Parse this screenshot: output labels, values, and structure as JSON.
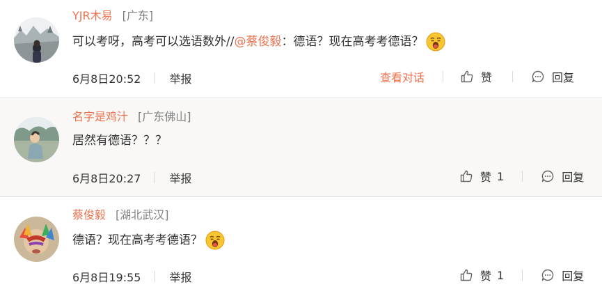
{
  "comments": [
    {
      "username": "YJR木易",
      "location": "[广东]",
      "text_before": "可以考呀，高考可以选语数外//",
      "mention": "@蔡俊毅",
      "text_after": "：德语？现在高考考德语？",
      "emoji": "shocked-face",
      "time": "6月8日20:52",
      "report": "举报",
      "view_conversation": "查看对话",
      "like_label": "赞",
      "like_count": "",
      "reply_label": "回复"
    },
    {
      "username": "名字是鸡汁",
      "location": "[广东佛山]",
      "text": "居然有德语？？？",
      "time": "6月8日20:27",
      "report": "举报",
      "like_label": "赞",
      "like_count": "1",
      "reply_label": "回复"
    },
    {
      "username": "蔡俊毅",
      "location": "[湖北武汉]",
      "text": "德语？现在高考考德语？",
      "emoji": "shocked-face",
      "time": "6月8日19:55",
      "report": "举报",
      "like_label": "赞",
      "like_count": "1",
      "reply_label": "回复"
    }
  ],
  "colors": {
    "accent": "#eb7350",
    "location": "#808080",
    "text": "#333333",
    "divider": "#e2e2e2",
    "alt_row_bg": "#f9f8f6"
  }
}
